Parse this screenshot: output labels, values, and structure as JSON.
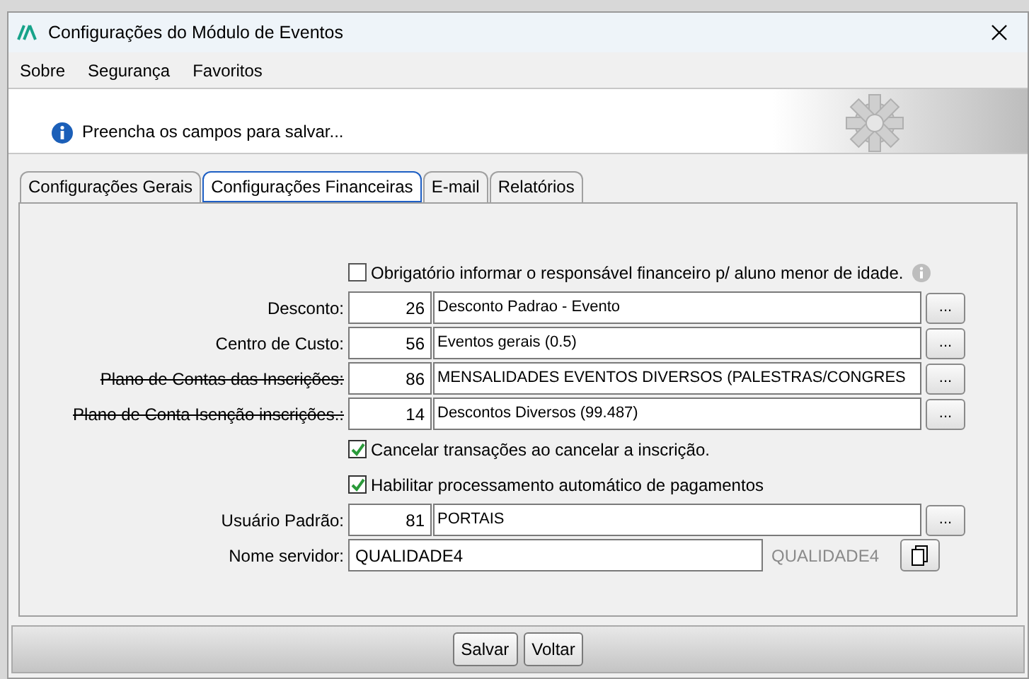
{
  "window": {
    "title": "Configurações do Módulo de Eventos"
  },
  "menu": [
    {
      "label": "Sobre"
    },
    {
      "label": "Segurança"
    },
    {
      "label": "Favoritos"
    }
  ],
  "header": {
    "message": "Preencha os campos para salvar..."
  },
  "tabs": [
    {
      "label": "Configurações Gerais",
      "selected": false
    },
    {
      "label": "Configurações Financeiras",
      "selected": true
    },
    {
      "label": "E-mail",
      "selected": false
    },
    {
      "label": "Relatórios",
      "selected": false
    }
  ],
  "form": {
    "rows": [
      {
        "kind": "checkbox",
        "label": "Obrigatório informar o responsável financeiro p/ aluno menor de idade.",
        "checked": false,
        "info": true
      },
      {
        "kind": "lookup",
        "label": "Desconto:",
        "code": "26",
        "description": "Desconto Padrao - Evento",
        "button": "...",
        "strikethrough": false
      },
      {
        "kind": "lookup",
        "label": "Centro de Custo:",
        "code": "56",
        "description": "Eventos gerais (0.5)",
        "button": "...",
        "strikethrough": false
      },
      {
        "kind": "lookup",
        "label": "Plano de Contas das Inscrições:",
        "code": "86",
        "description": "MENSALIDADES EVENTOS DIVERSOS (PALESTRAS/CONGRES",
        "button": "...",
        "strikethrough": true
      },
      {
        "kind": "lookup",
        "label": "Plano de Conta Isenção inscrições.:",
        "code": "14",
        "description": "Descontos Diversos (99.487)",
        "button": "...",
        "strikethrough": true
      },
      {
        "kind": "checkbox",
        "label": "Cancelar transações ao cancelar a inscrição.",
        "checked": true,
        "info": false
      },
      {
        "kind": "checkbox",
        "label": "Habilitar processamento automático de pagamentos",
        "checked": true,
        "info": false
      },
      {
        "kind": "lookup",
        "label": "Usuário Padrão:",
        "code": "81",
        "description": "PORTAIS",
        "button": "...",
        "strikethrough": false
      },
      {
        "kind": "server",
        "label": "Nome servidor:",
        "value": "QUALIDADE4",
        "hint": "QUALIDADE4"
      }
    ]
  },
  "buttons": [
    {
      "label": "Salvar"
    },
    {
      "label": "Voltar"
    }
  ]
}
